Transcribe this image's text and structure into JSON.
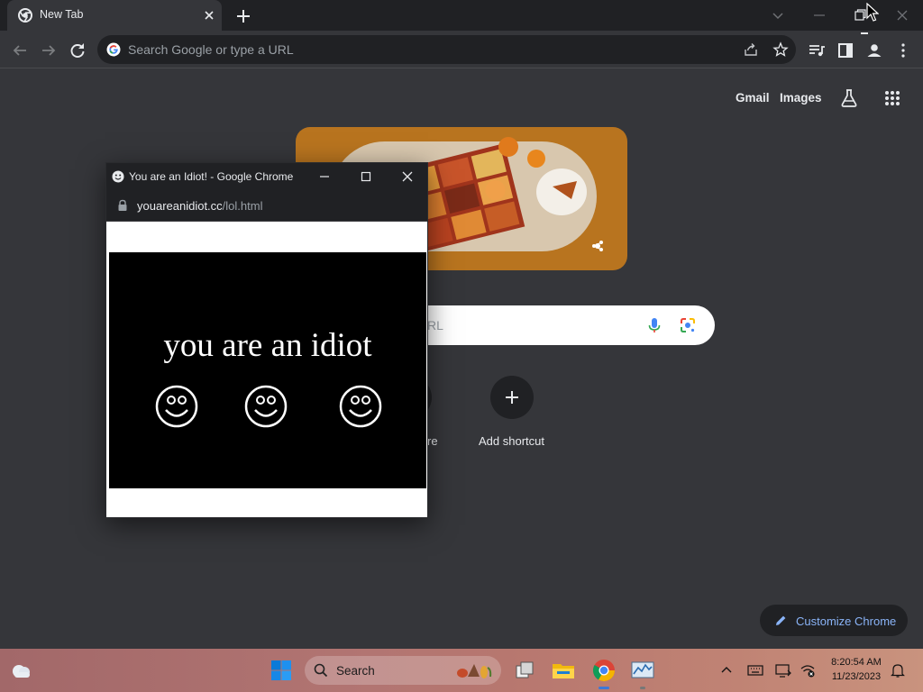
{
  "browser": {
    "tab_title": "New Tab",
    "omnibox_placeholder": "Search Google or type a URL"
  },
  "ntp": {
    "gmail": "Gmail",
    "images": "Images",
    "search_placeholder_visible": "RL",
    "shortcut_partial_label": "re",
    "add_shortcut": "Add shortcut",
    "customize": "Customize Chrome"
  },
  "popup": {
    "title": "You are an Idiot! - Google Chrome",
    "url_host": "youareanidiot.cc",
    "url_path": "/lol.html",
    "message": "you are an idiot"
  },
  "taskbar": {
    "search_label": "Search",
    "time": "8:20:54 AM",
    "date": "11/23/2023"
  },
  "icons": [
    "chrome-icon",
    "close-icon",
    "new-tab-icon",
    "back-icon",
    "forward-icon",
    "reload-icon",
    "google-g-icon",
    "share-icon",
    "star-icon",
    "media-icon",
    "side-panel-icon",
    "profile-icon",
    "menu-icon",
    "labs-icon",
    "apps-grid-icon",
    "mic-icon",
    "lens-icon",
    "plus-icon",
    "pencil-icon",
    "smiley-icon",
    "lock-icon",
    "weather-icon",
    "windows-start-icon",
    "search-icon",
    "task-view-icon",
    "file-explorer-icon",
    "resource-monitor-icon",
    "chevron-up-icon",
    "keyboard-icon",
    "display-icon",
    "network-off-icon",
    "bell-icon"
  ],
  "colors": {
    "chrome_dark": "#202124",
    "ntp_background": "#35363a",
    "accent_blue": "#8ab4f8",
    "doodle_orange": "#b8741f",
    "popup_black": "#000000"
  }
}
